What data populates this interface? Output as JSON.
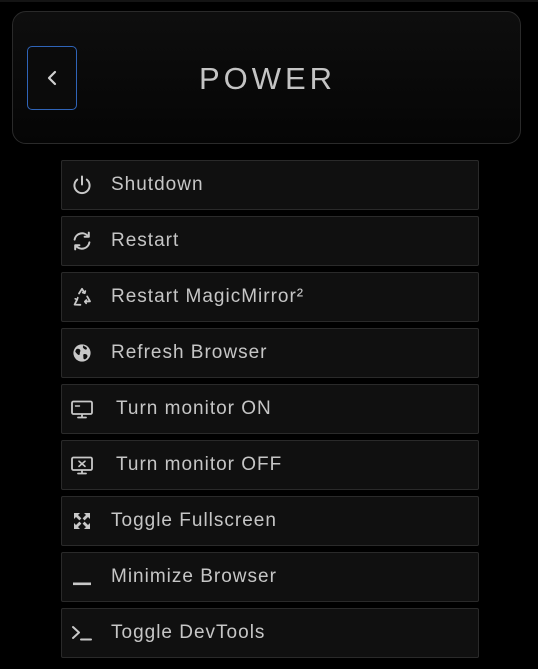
{
  "header": {
    "title": "POWER",
    "back_icon": "chevron-left-icon",
    "accent_color": "#2f64b8"
  },
  "menu": {
    "items": [
      {
        "label": "Shutdown",
        "icon": "power-icon"
      },
      {
        "label": "Restart",
        "icon": "refresh-icon"
      },
      {
        "label": "Restart MagicMirror²",
        "icon": "recycle-icon"
      },
      {
        "label": "Refresh Browser",
        "icon": "globe-icon"
      },
      {
        "label": "Turn monitor ON",
        "icon": "monitor-on-icon"
      },
      {
        "label": "Turn monitor OFF",
        "icon": "monitor-off-icon"
      },
      {
        "label": "Toggle Fullscreen",
        "icon": "fullscreen-icon"
      },
      {
        "label": "Minimize Browser",
        "icon": "minimize-icon"
      },
      {
        "label": "Toggle DevTools",
        "icon": "terminal-icon"
      }
    ]
  }
}
